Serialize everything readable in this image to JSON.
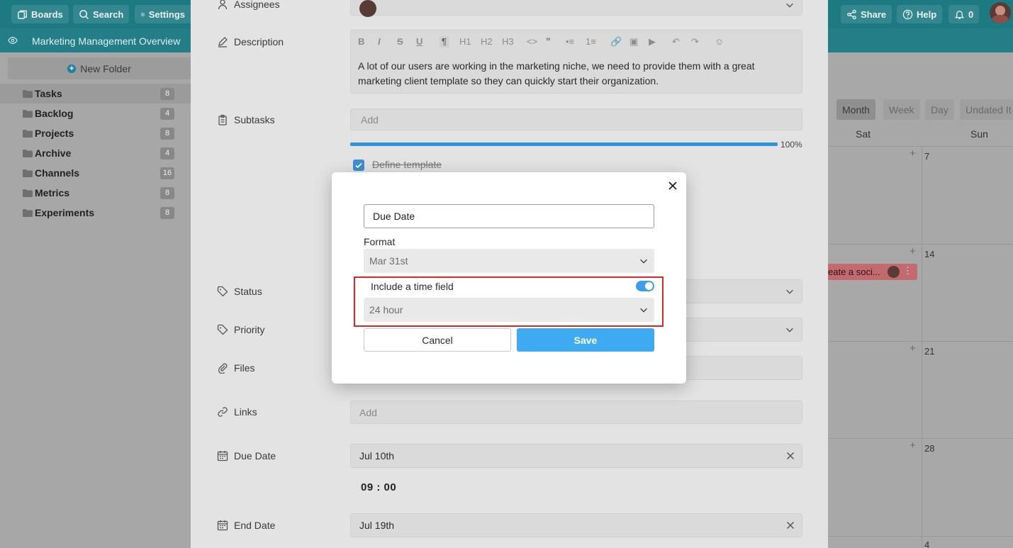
{
  "topbar": {
    "boards_label": "Boards",
    "search_label": "Search",
    "settings_label": "Settings",
    "share_label": "Share",
    "help_label": "Help",
    "notifications_count": "0"
  },
  "subbar": {
    "title": "Marketing Management Overview"
  },
  "sidebar": {
    "new_folder_label": "New Folder",
    "folders": [
      {
        "label": "Tasks",
        "count": "8"
      },
      {
        "label": "Backlog",
        "count": "4"
      },
      {
        "label": "Projects",
        "count": "8"
      },
      {
        "label": "Archive",
        "count": "4"
      },
      {
        "label": "Channels",
        "count": "16"
      },
      {
        "label": "Metrics",
        "count": "8"
      },
      {
        "label": "Experiments",
        "count": "8"
      }
    ]
  },
  "task": {
    "assignees_label": "Assignees",
    "description_label": "Description",
    "description_text": "A lot of our users are working in the marketing niche, we need to provide them with a great marketing client template so they can quickly start their organization.",
    "toolbar": [
      "B",
      "I",
      "S",
      "U",
      "¶",
      "H1",
      "H2",
      "H3",
      "<>",
      "❞",
      "•≡",
      "1≡",
      "🔗",
      "▣",
      "▶",
      "↶",
      "↷",
      "☺"
    ],
    "subtasks_label": "Subtasks",
    "subtasks_placeholder": "Add",
    "progress_pct": "100%",
    "progress_value": 1.0,
    "subtask_item": "Define template",
    "status_label": "Status",
    "priority_label": "Priority",
    "files_label": "Files",
    "links_label": "Links",
    "links_placeholder": "Add",
    "due_date_label": "Due Date",
    "due_date_value": "Jul 10th",
    "due_time_hours": "09",
    "due_time_sep": ":",
    "due_time_minutes": "00",
    "end_date_label": "End Date",
    "end_date_value": "Jul 19th"
  },
  "calendar": {
    "views": [
      "Month",
      "Week",
      "Day",
      "Undated It"
    ],
    "active_view": "Month",
    "day_headers": [
      "Sat",
      "Sun"
    ],
    "day_numbers": [
      "7",
      "14",
      "21",
      "28",
      "4"
    ],
    "event_label": "eate a soci..."
  },
  "modal": {
    "name_value": "Due Date",
    "format_label": "Format",
    "format_value": "Mar 31st",
    "include_time_label": "Include a time field",
    "include_time_enabled": true,
    "time_format_value": "24 hour",
    "cancel_label": "Cancel",
    "save_label": "Save"
  },
  "colors": {
    "topbar": "#1d7a82",
    "accent_blue": "#3daaf2",
    "highlight_red": "#d62828"
  }
}
